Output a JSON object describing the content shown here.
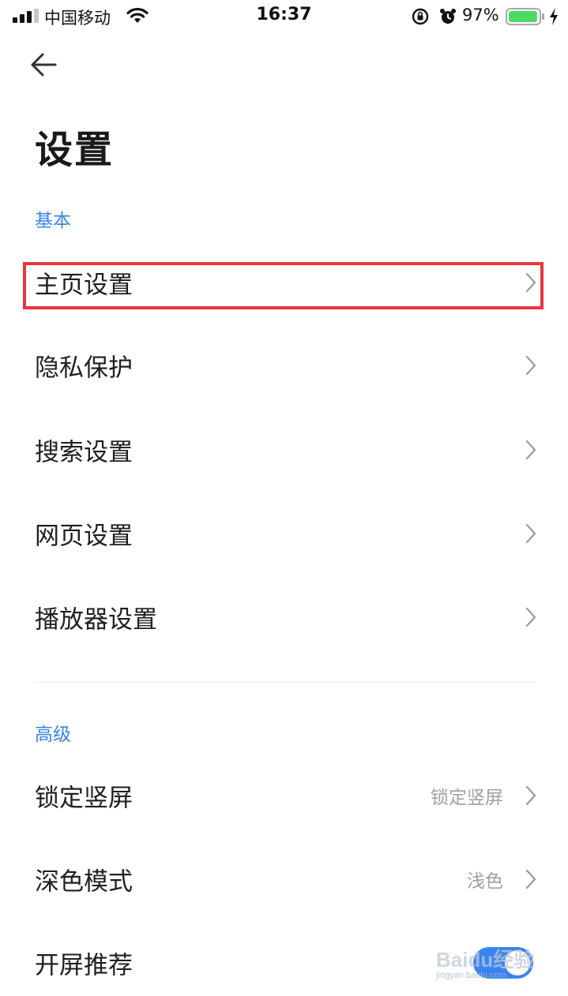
{
  "status_bar": {
    "carrier": "中国移动",
    "time": "16:37",
    "battery_percent": "97%",
    "battery_level": 0.97,
    "icons": [
      "signal-icon",
      "wifi-icon",
      "rotation-lock-icon",
      "alarm-icon",
      "battery-icon",
      "charging-icon"
    ]
  },
  "header": {
    "back_icon": "back-arrow-icon",
    "title": "设置"
  },
  "sections": {
    "basic": {
      "label": "基本",
      "items": [
        {
          "label": "主页设置"
        },
        {
          "label": "隐私保护"
        },
        {
          "label": "搜索设置"
        },
        {
          "label": "网页设置"
        },
        {
          "label": "播放器设置"
        }
      ]
    },
    "advanced": {
      "label": "高级",
      "items": [
        {
          "label": "锁定竖屏",
          "value": "锁定竖屏"
        },
        {
          "label": "深色模式",
          "value": "浅色"
        },
        {
          "label": "开屏推荐",
          "toggle": true
        }
      ]
    }
  },
  "colors": {
    "accent": "#3a84f0",
    "highlight": "#e8363c",
    "battery": "#4cd964"
  },
  "watermark": {
    "text": "Baidu经验",
    "subtext": "jingyan.baidu.com"
  }
}
